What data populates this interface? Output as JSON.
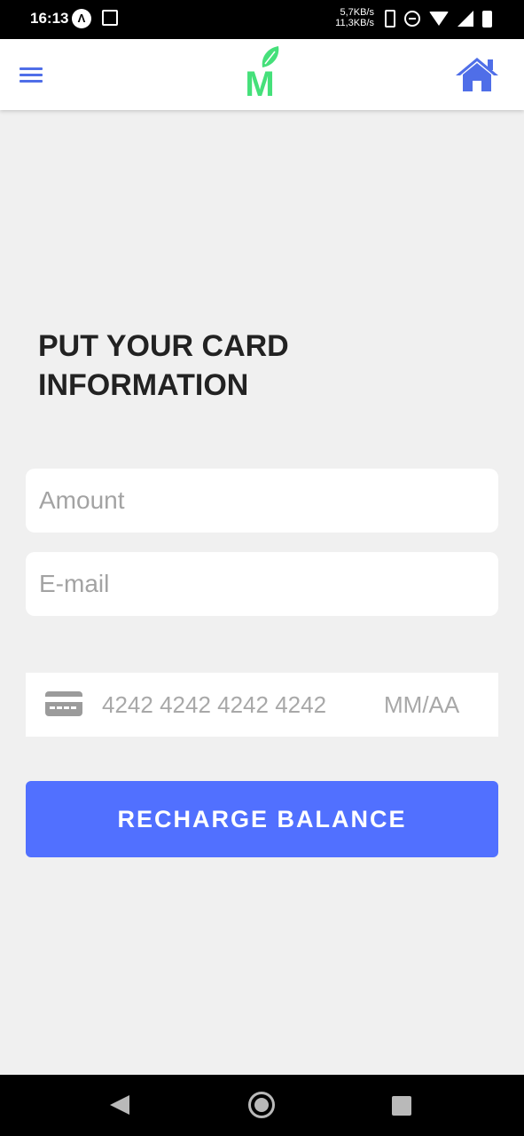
{
  "status_bar": {
    "time": "16:13",
    "badge_letter": "Λ",
    "net_up": "5,7KB/s",
    "net_down": "11,3KB/s"
  },
  "app_bar": {
    "logo_letter": "M",
    "menu_icon": "hamburger-menu-icon",
    "home_icon": "home-icon",
    "accent_color": "#4f6ee8",
    "logo_color": "#45e07a"
  },
  "form": {
    "title": "PUT YOUR CARD\nINFORMATION",
    "amount": {
      "value": "",
      "placeholder": "Amount"
    },
    "email": {
      "value": "",
      "placeholder": "E-mail"
    },
    "card": {
      "icon": "credit-card-icon",
      "number_placeholder": "4242 4242 4242 4242",
      "expiry_placeholder": "MM/AA"
    },
    "submit_label": "RECHARGE BALANCE",
    "button_color": "#5170ff"
  },
  "nav_bar": {
    "back_icon": "back-triangle-icon",
    "home_icon": "home-circle-icon",
    "recents_icon": "recents-square-icon"
  }
}
